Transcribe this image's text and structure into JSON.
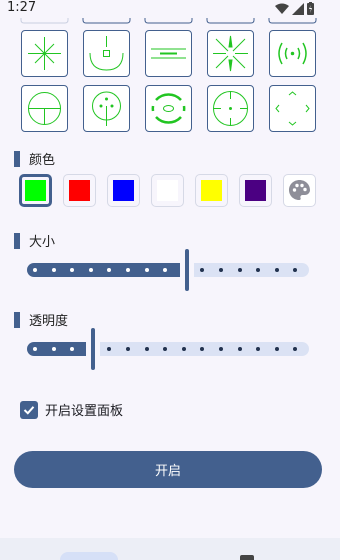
{
  "status": {
    "time": "1:27"
  },
  "grid": {
    "crosshairs": [
      "crosshair-star",
      "crosshair-u-arc",
      "crosshair-horizontal-lines",
      "crosshair-converging",
      "crosshair-brackets",
      "crosshair-circle-split",
      "crosshair-circle-dotted",
      "crosshair-ring-ellipse",
      "crosshair-ring-dashed",
      "crosshair-corner-arrows"
    ],
    "selected_index": null,
    "line_color": "#22c522"
  },
  "color_section": {
    "title": "颜色",
    "swatches": [
      "#00ff00",
      "#ff0000",
      "#0000ff",
      "#ffffff",
      "#ffff00",
      "#4b0082"
    ],
    "selected_index": 0,
    "custom_icon": "palette-icon"
  },
  "size_section": {
    "title": "大小",
    "value_fraction": 0.57
  },
  "opacity_section": {
    "title": "透明度",
    "value_fraction": 0.23
  },
  "settings_panel": {
    "label": "开启设置面板",
    "checked": true
  },
  "primary_button": {
    "label": "开启"
  },
  "colors": {
    "accent": "#43608e",
    "track_inactive": "#dbe2f4"
  }
}
